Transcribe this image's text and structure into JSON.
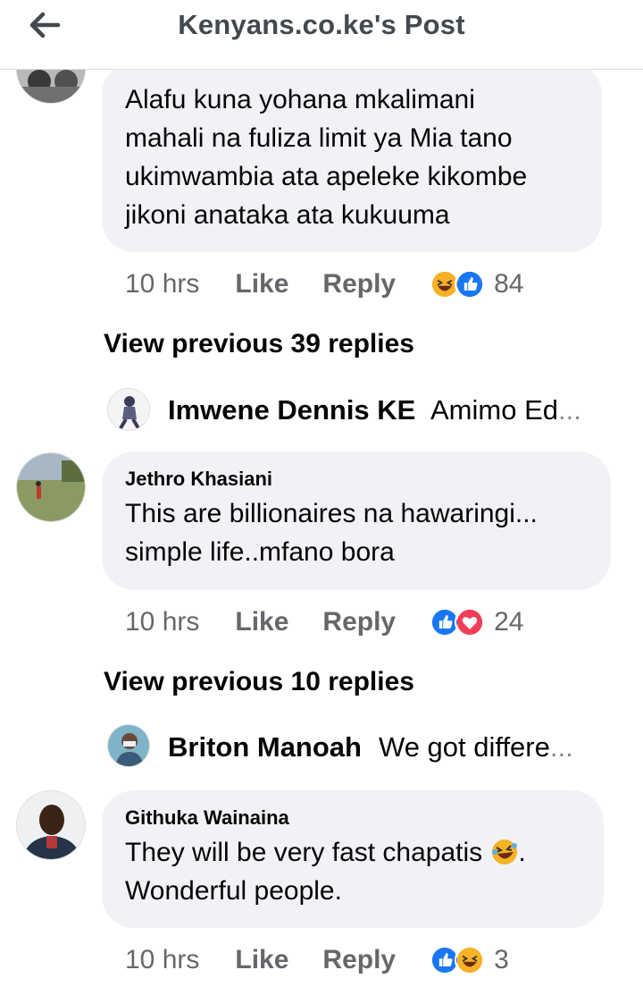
{
  "header": {
    "title": "Kenyans.co.ke's Post",
    "back_icon": "arrow-left-icon"
  },
  "comments": [
    {
      "author": "",
      "lines": [
        "Alafu kuna yohana mkalimani",
        "mahali na fuliza limit ya Mia tano",
        "ukimwambia ata apeleke kikombe",
        "jikoni anataka ata kukuuma"
      ],
      "time": "10 hrs",
      "like_label": "Like",
      "reply_label": "Reply",
      "reactions": [
        "haha-icon",
        "like-icon"
      ],
      "reaction_count": "84",
      "view_previous": "View previous 39 replies",
      "latest_reply": {
        "name": "Imwene Dennis KE",
        "snippet": "Amimo Ed",
        "ellipsis": "..."
      }
    },
    {
      "author": "Jethro Khasiani",
      "lines": [
        "This are billionaires na hawaringi...",
        "simple life..mfano bora"
      ],
      "time": "10 hrs",
      "like_label": "Like",
      "reply_label": "Reply",
      "reactions": [
        "like-icon",
        "love-icon"
      ],
      "reaction_count": "24",
      "view_previous": "View previous 10 replies",
      "latest_reply": {
        "name": "Briton Manoah",
        "snippet": "We got differe",
        "ellipsis": "..."
      }
    },
    {
      "author": "Githuka Wainaina",
      "line1_prefix": "They will be very fast chapatis ",
      "line1_suffix": ".",
      "line2": "Wonderful people.",
      "time": "10 hrs",
      "like_label": "Like",
      "reply_label": "Reply",
      "reactions": [
        "like-icon",
        "haha-icon"
      ],
      "reaction_count": "3"
    }
  ],
  "colors": {
    "bubble": "#f0f2f5",
    "meta_gray": "#65676b",
    "like_blue": "#1877f2",
    "love_red": "#f33e58",
    "haha_yellow": "#f7b125"
  }
}
